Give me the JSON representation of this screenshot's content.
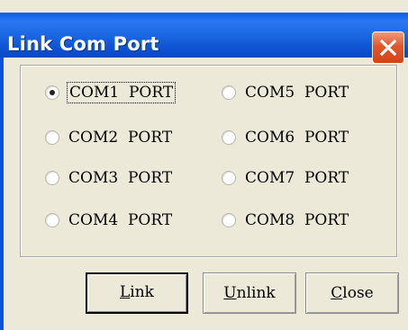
{
  "window": {
    "title": "Link Com Port"
  },
  "ports": {
    "options": [
      {
        "label": "COM1  PORT",
        "checked": true
      },
      {
        "label": "COM5  PORT",
        "checked": false
      },
      {
        "label": "COM2  PORT",
        "checked": false
      },
      {
        "label": "COM6  PORT",
        "checked": false
      },
      {
        "label": "COM3  PORT",
        "checked": false
      },
      {
        "label": "COM7  PORT",
        "checked": false
      },
      {
        "label": "COM4  PORT",
        "checked": false
      },
      {
        "label": "COM8  PORT",
        "checked": false
      }
    ]
  },
  "buttons": {
    "link": {
      "mnemonic": "L",
      "rest": "ink"
    },
    "unlink": {
      "mnemonic": "U",
      "rest": "nlink"
    },
    "close": {
      "mnemonic": "C",
      "rest": "lose"
    }
  },
  "colors": {
    "titlebar": "#1964df",
    "dialog_bg": "#ece9d8",
    "close_button": "#e2562b"
  },
  "icons": {
    "close": "close-icon"
  }
}
